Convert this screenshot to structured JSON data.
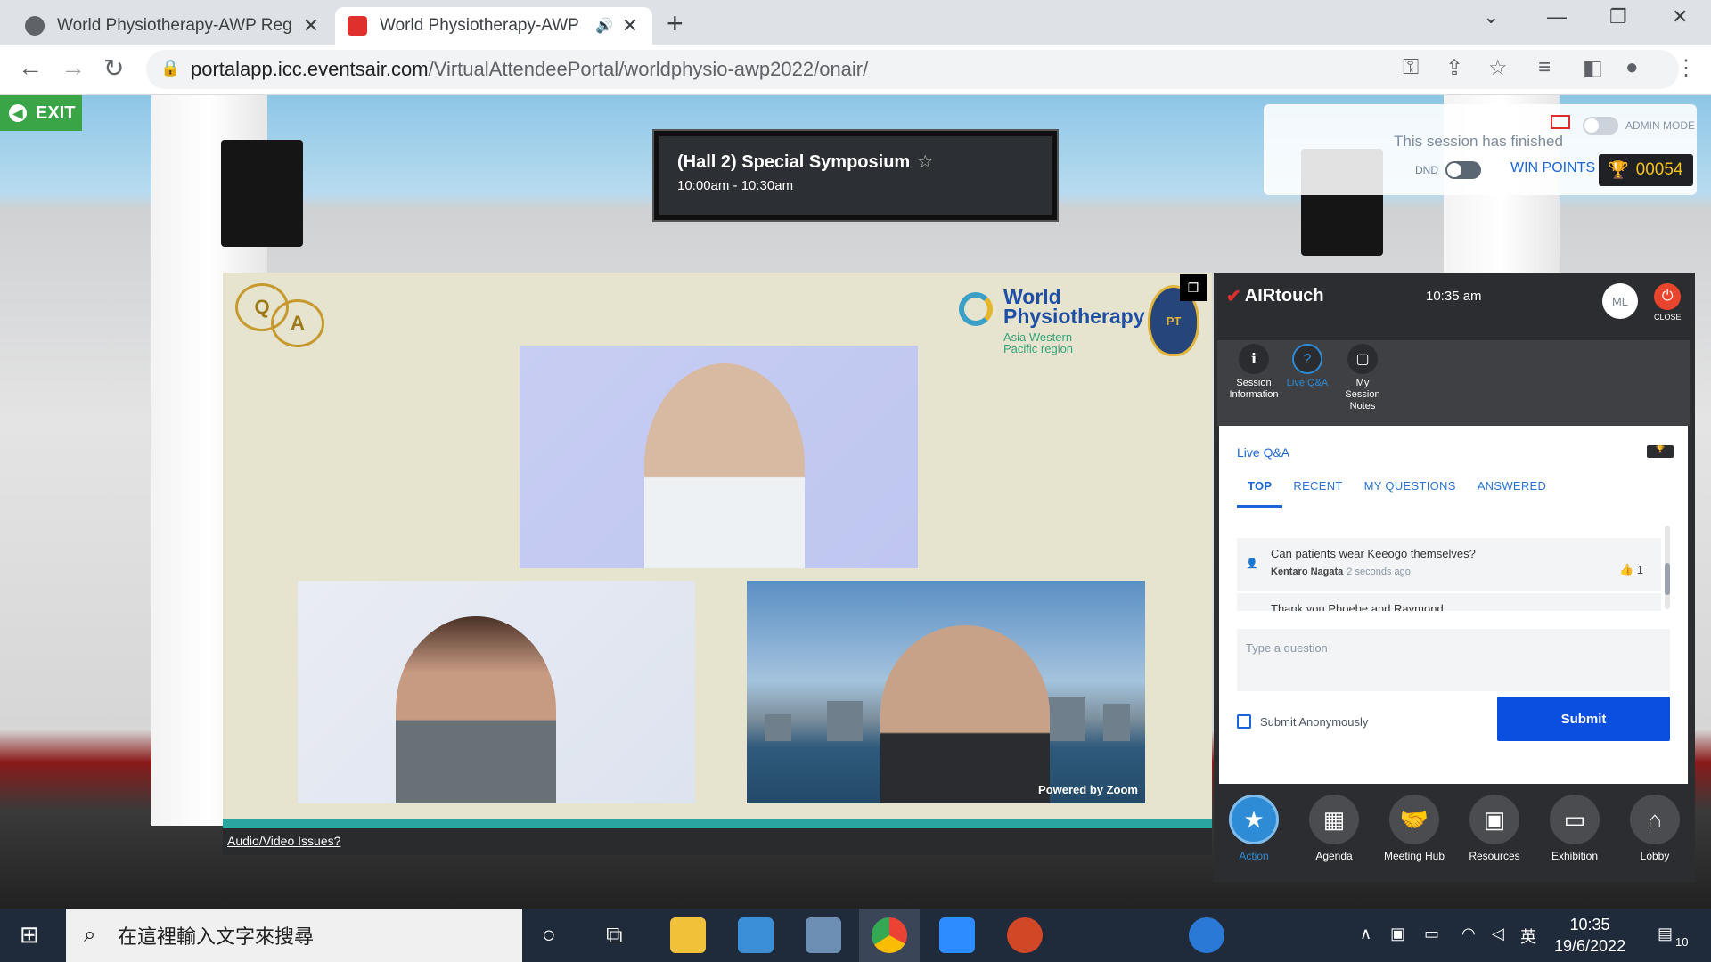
{
  "browser": {
    "tabs": [
      {
        "title": "World Physiotherapy-AWP Reg",
        "active": false
      },
      {
        "title": "World Physiotherapy-AWP",
        "active": true
      }
    ],
    "url_host": "portalapp.icc.eventsair.com",
    "url_path": "/VirtualAttendeePortal/worldphysio-awp2022/onair/"
  },
  "hall": {
    "exit_label": "EXIT",
    "session_title": "(Hall 2) Special Symposium",
    "session_time": "10:00am - 10:30am",
    "status_text": "This session has finished",
    "admin_mode_label": "ADMIN MODE",
    "dnd_label": "DND",
    "win_points_label": "WIN POINTS",
    "points": "00054"
  },
  "video": {
    "qa_q": "Q",
    "qa_a": "A",
    "wp_logo_line1": "World",
    "wp_logo_line2": "Physiotherapy",
    "wp_logo_region1": "Asia Western",
    "wp_logo_region2": "Pacific region",
    "crest_text": "PT",
    "powered_by": "Powered by Zoom",
    "av_issues": "Audio/Video Issues?"
  },
  "airtouch": {
    "logo": "AIRtouch",
    "time": "10:35 am",
    "avatar_initials": "ML",
    "close_label": "CLOSE",
    "menu": [
      {
        "label1": "Session",
        "label2": "Information",
        "label3": "",
        "active": false
      },
      {
        "label1": "Live Q&A",
        "label2": "",
        "label3": "",
        "active": true
      },
      {
        "label1": "My",
        "label2": "Session",
        "label3": "Notes",
        "active": false
      }
    ],
    "qa": {
      "heading": "Live Q&A",
      "tabs": [
        "TOP",
        "RECENT",
        "MY QUESTIONS",
        "ANSWERED"
      ],
      "questions": [
        {
          "text": "Can patients wear Keeogo themselves?",
          "author": "Kentaro Nagata",
          "time": "2 seconds ago",
          "likes": "1"
        },
        {
          "text": "Thank you Phoebe and Raymond.",
          "author": "",
          "time": "",
          "likes": ""
        }
      ],
      "input_placeholder": "Type a question",
      "anonymous_label": "Submit Anonymously",
      "submit_label": "Submit"
    },
    "nav": [
      {
        "label": "Action",
        "icon": "star-icon",
        "active": true
      },
      {
        "label": "Agenda",
        "icon": "calendar-icon",
        "active": false
      },
      {
        "label": "Meeting Hub",
        "icon": "handshake-icon",
        "active": false
      },
      {
        "label": "Resources",
        "icon": "images-icon",
        "active": false
      },
      {
        "label": "Exhibition",
        "icon": "monitor-icon",
        "active": false
      },
      {
        "label": "Lobby",
        "icon": "home-icon",
        "active": false
      }
    ]
  },
  "taskbar": {
    "search_placeholder": "在這裡輸入文字來搜尋",
    "time": "10:35",
    "date": "19/6/2022",
    "ime": "英",
    "notifications": "10"
  },
  "colors": {
    "accent_blue": "#1a66d8",
    "submit_blue": "#0b4fe0",
    "exit_green": "#3aa547",
    "close_red": "#e8452c",
    "points_gold": "#f3c21a"
  }
}
